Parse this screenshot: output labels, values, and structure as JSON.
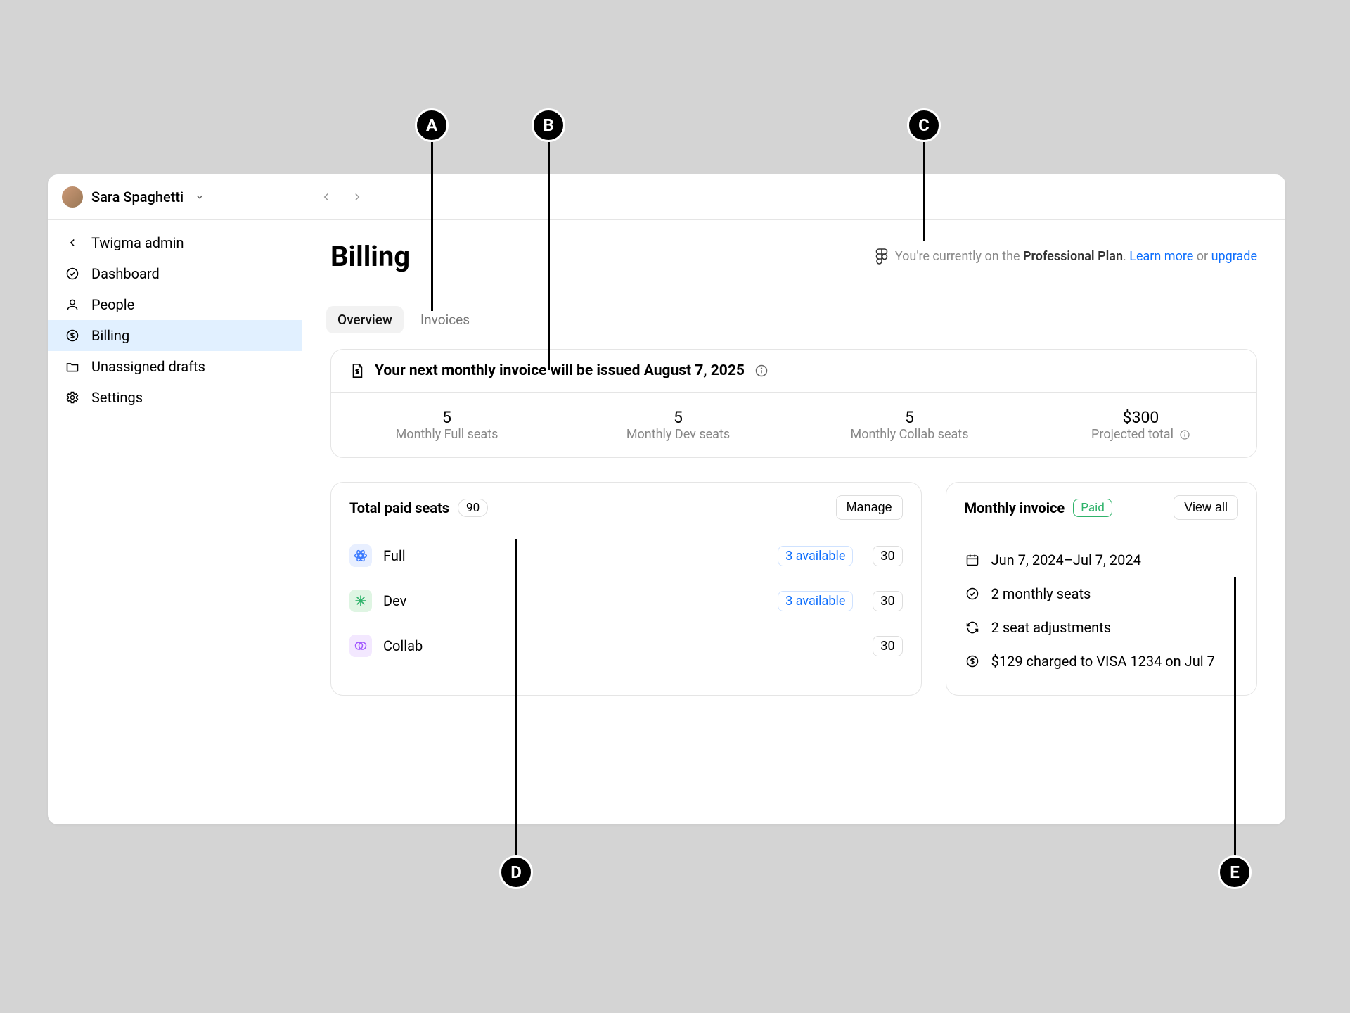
{
  "user": {
    "name": "Sara Spaghetti"
  },
  "sidebar": {
    "backLabel": "Twigma admin",
    "items": [
      {
        "label": "Dashboard"
      },
      {
        "label": "People"
      },
      {
        "label": "Billing"
      },
      {
        "label": "Unassigned drafts"
      },
      {
        "label": "Settings"
      }
    ]
  },
  "page": {
    "title": "Billing"
  },
  "plan": {
    "prefix": "You're currently on the ",
    "planName": "Professional Plan",
    "suffix": ". ",
    "learnMore": "Learn more",
    "or": " or ",
    "upgrade": "upgrade"
  },
  "tabs": {
    "overview": "Overview",
    "invoices": "Invoices"
  },
  "banner": {
    "text": "Your next monthly invoice will be issued August 7, 2025",
    "stats": [
      {
        "value": "5",
        "label": "Monthly Full seats"
      },
      {
        "value": "5",
        "label": "Monthly Dev seats"
      },
      {
        "value": "5",
        "label": "Monthly Collab seats"
      },
      {
        "value": "$300",
        "label": "Projected total"
      }
    ]
  },
  "seats": {
    "title": "Total paid seats",
    "count": "90",
    "manage": "Manage",
    "rows": [
      {
        "name": "Full",
        "available": "3 available",
        "count": "30"
      },
      {
        "name": "Dev",
        "available": "3 available",
        "count": "30"
      },
      {
        "name": "Collab",
        "count": "30"
      }
    ]
  },
  "invoice": {
    "title": "Monthly invoice",
    "paid": "Paid",
    "viewAll": "View all",
    "lines": {
      "date": "Jun 7, 2024–Jul 7, 2024",
      "seats": "2 monthly seats",
      "adjust": "2 seat adjustments",
      "charge": "$129 charged to VISA 1234 on Jul 7"
    }
  },
  "callouts": {
    "a": "A",
    "b": "B",
    "c": "C",
    "d": "D",
    "e": "E"
  }
}
